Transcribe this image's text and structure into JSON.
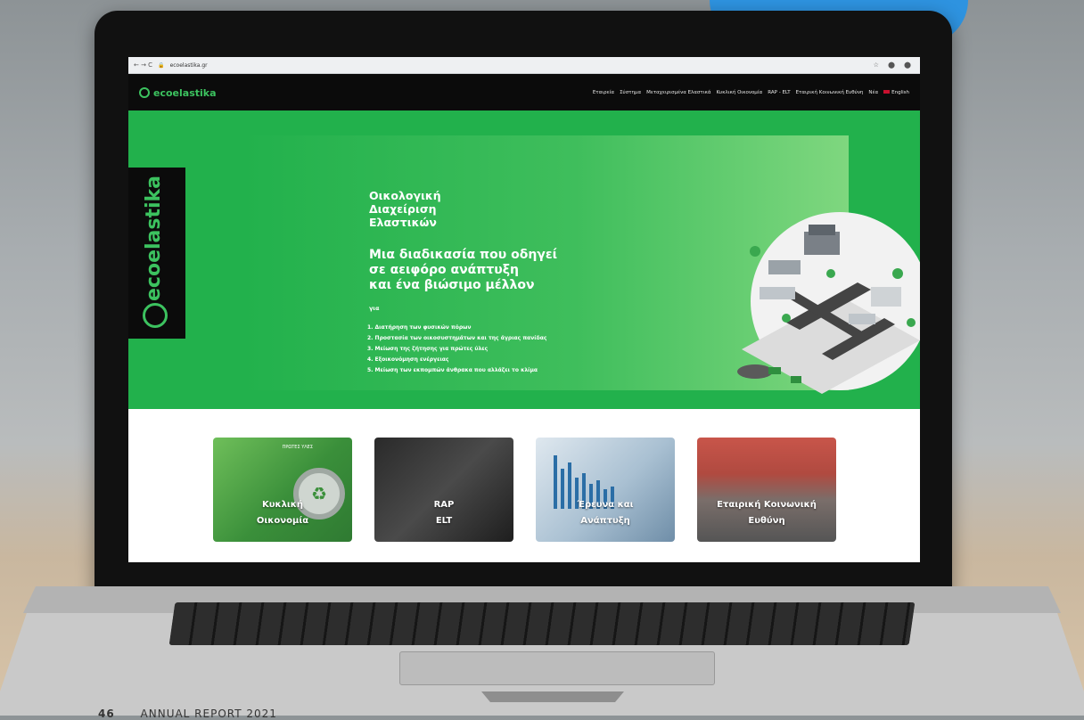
{
  "browser": {
    "url": "ecoelastika.gr",
    "nav_glyphs": "←  →  C",
    "right_glyphs": "☆ ⬤ ⬤"
  },
  "site": {
    "logo": "ecoelastika",
    "menu": [
      "Εταιρεία",
      "Σύστημα",
      "Μεταχειρισμένα Ελαστικά",
      "Κυκλική Οικονομία",
      "RAP - ELT",
      "Εταιρική Κοινωνική Ευθύνη",
      "Νέα",
      "English"
    ]
  },
  "hero": {
    "side_logo": "ecoelastika",
    "headline_lines": [
      "Οικολογική",
      "Διαχείριση",
      "Ελαστικών"
    ],
    "subheadline_lines": [
      "Μια διαδικασία που οδηγεί",
      "σε αειφόρο ανάπτυξη",
      "και ένα βιώσιμο μέλλον"
    ],
    "gia_label": "για",
    "list": [
      "1. Διατήρηση των φυσικών πόρων",
      "2. Προστασία των οικοσυστημάτων και της άγριας πανίδας",
      "3. Μείωση της ζήτησης για πρώτες ύλες",
      "4. Εξοικονόμηση ενέργειας",
      "5. Μείωση των εκπομπών άνθρακα που αλλάζει το κλίμα"
    ]
  },
  "cards": [
    {
      "lines": [
        "Κυκλική",
        "Οικονομία"
      ],
      "inner_text": "ΠΡΩΤΕΣ ΥΛΕΣ",
      "color": "#4caf50"
    },
    {
      "lines": [
        "RAP",
        "ELT"
      ],
      "color": "#333333"
    },
    {
      "lines": [
        "Έρευνα και",
        "Ανάπτυξη"
      ],
      "color": "#9fb8c9"
    },
    {
      "lines": [
        "Εταιρική Κοινωνική",
        "Ευθύνη"
      ],
      "color": "#c8554a"
    }
  ],
  "footer": {
    "page_number": "46",
    "caption": "ANNUAL REPORT 2021"
  },
  "colors": {
    "brand_green": "#22b14c",
    "logo_green": "#3cc25f",
    "nav_bg": "#0b0b0b"
  }
}
